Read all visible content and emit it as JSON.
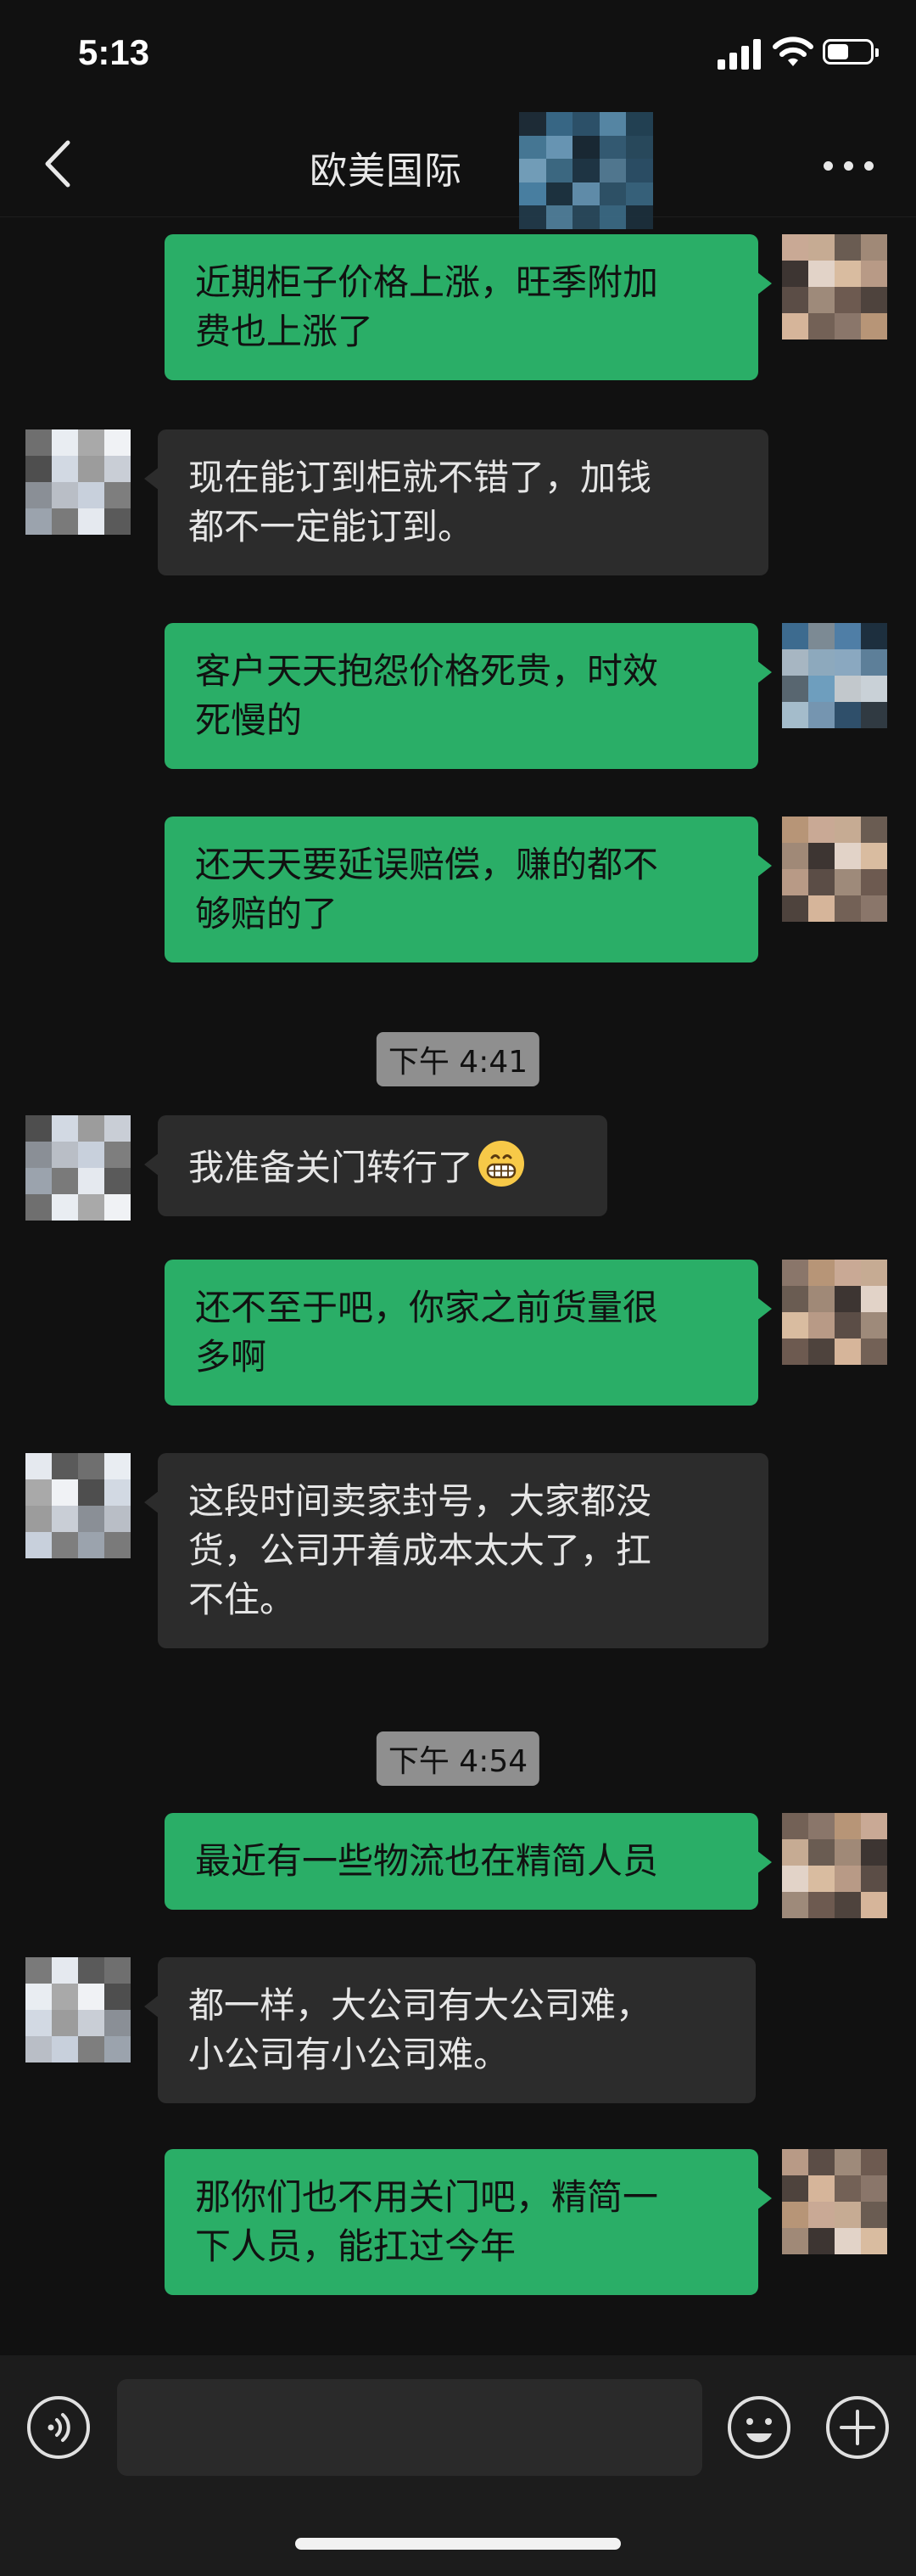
{
  "status_bar": {
    "time": "5:13"
  },
  "nav": {
    "title": "欧美国际"
  },
  "messages": [
    {
      "side": "mine",
      "lines": [
        "近期柜子价格上涨，旺季附加",
        "费也上涨了"
      ]
    },
    {
      "side": "theirs",
      "lines": [
        "现在能订到柜就不错了，加钱",
        "都不一定能订到。"
      ]
    },
    {
      "side": "mine",
      "lines": [
        "客户天天抱怨价格死贵，时效",
        "死慢的"
      ]
    },
    {
      "side": "mine",
      "lines": [
        "还天天要延误赔偿，赚的都不",
        "够赔的了"
      ]
    },
    {
      "type": "time",
      "text": "下午 4:41"
    },
    {
      "side": "theirs",
      "lines": [
        "我准备关门转行了"
      ],
      "emoji": "grinning-face"
    },
    {
      "side": "mine",
      "lines": [
        "还不至于吧，你家之前货量很",
        "多啊"
      ]
    },
    {
      "side": "theirs",
      "lines": [
        "这段时间卖家封号，大家都没",
        "货，公司开着成本太大了，扛",
        "不住。"
      ]
    },
    {
      "type": "time",
      "text": "下午 4:54"
    },
    {
      "side": "mine",
      "lines": [
        "最近有一些物流也在精简人员"
      ]
    },
    {
      "side": "theirs",
      "lines": [
        "都一样，大公司有大公司难，",
        "小公司有小公司难。"
      ]
    },
    {
      "side": "mine",
      "lines": [
        "那你们也不用关门吧，精简一",
        "下人员，能扛过今年"
      ]
    }
  ],
  "input": {
    "value": ""
  },
  "icons": {
    "back": "chevron-left-icon",
    "more": "more-dots-icon",
    "voice": "voice-icon",
    "emoji": "emoji-icon",
    "plus": "plus-icon"
  },
  "colors": {
    "mine_bubble": "#2aae67",
    "theirs_bubble": "#2c2c2c",
    "background": "#111111"
  }
}
